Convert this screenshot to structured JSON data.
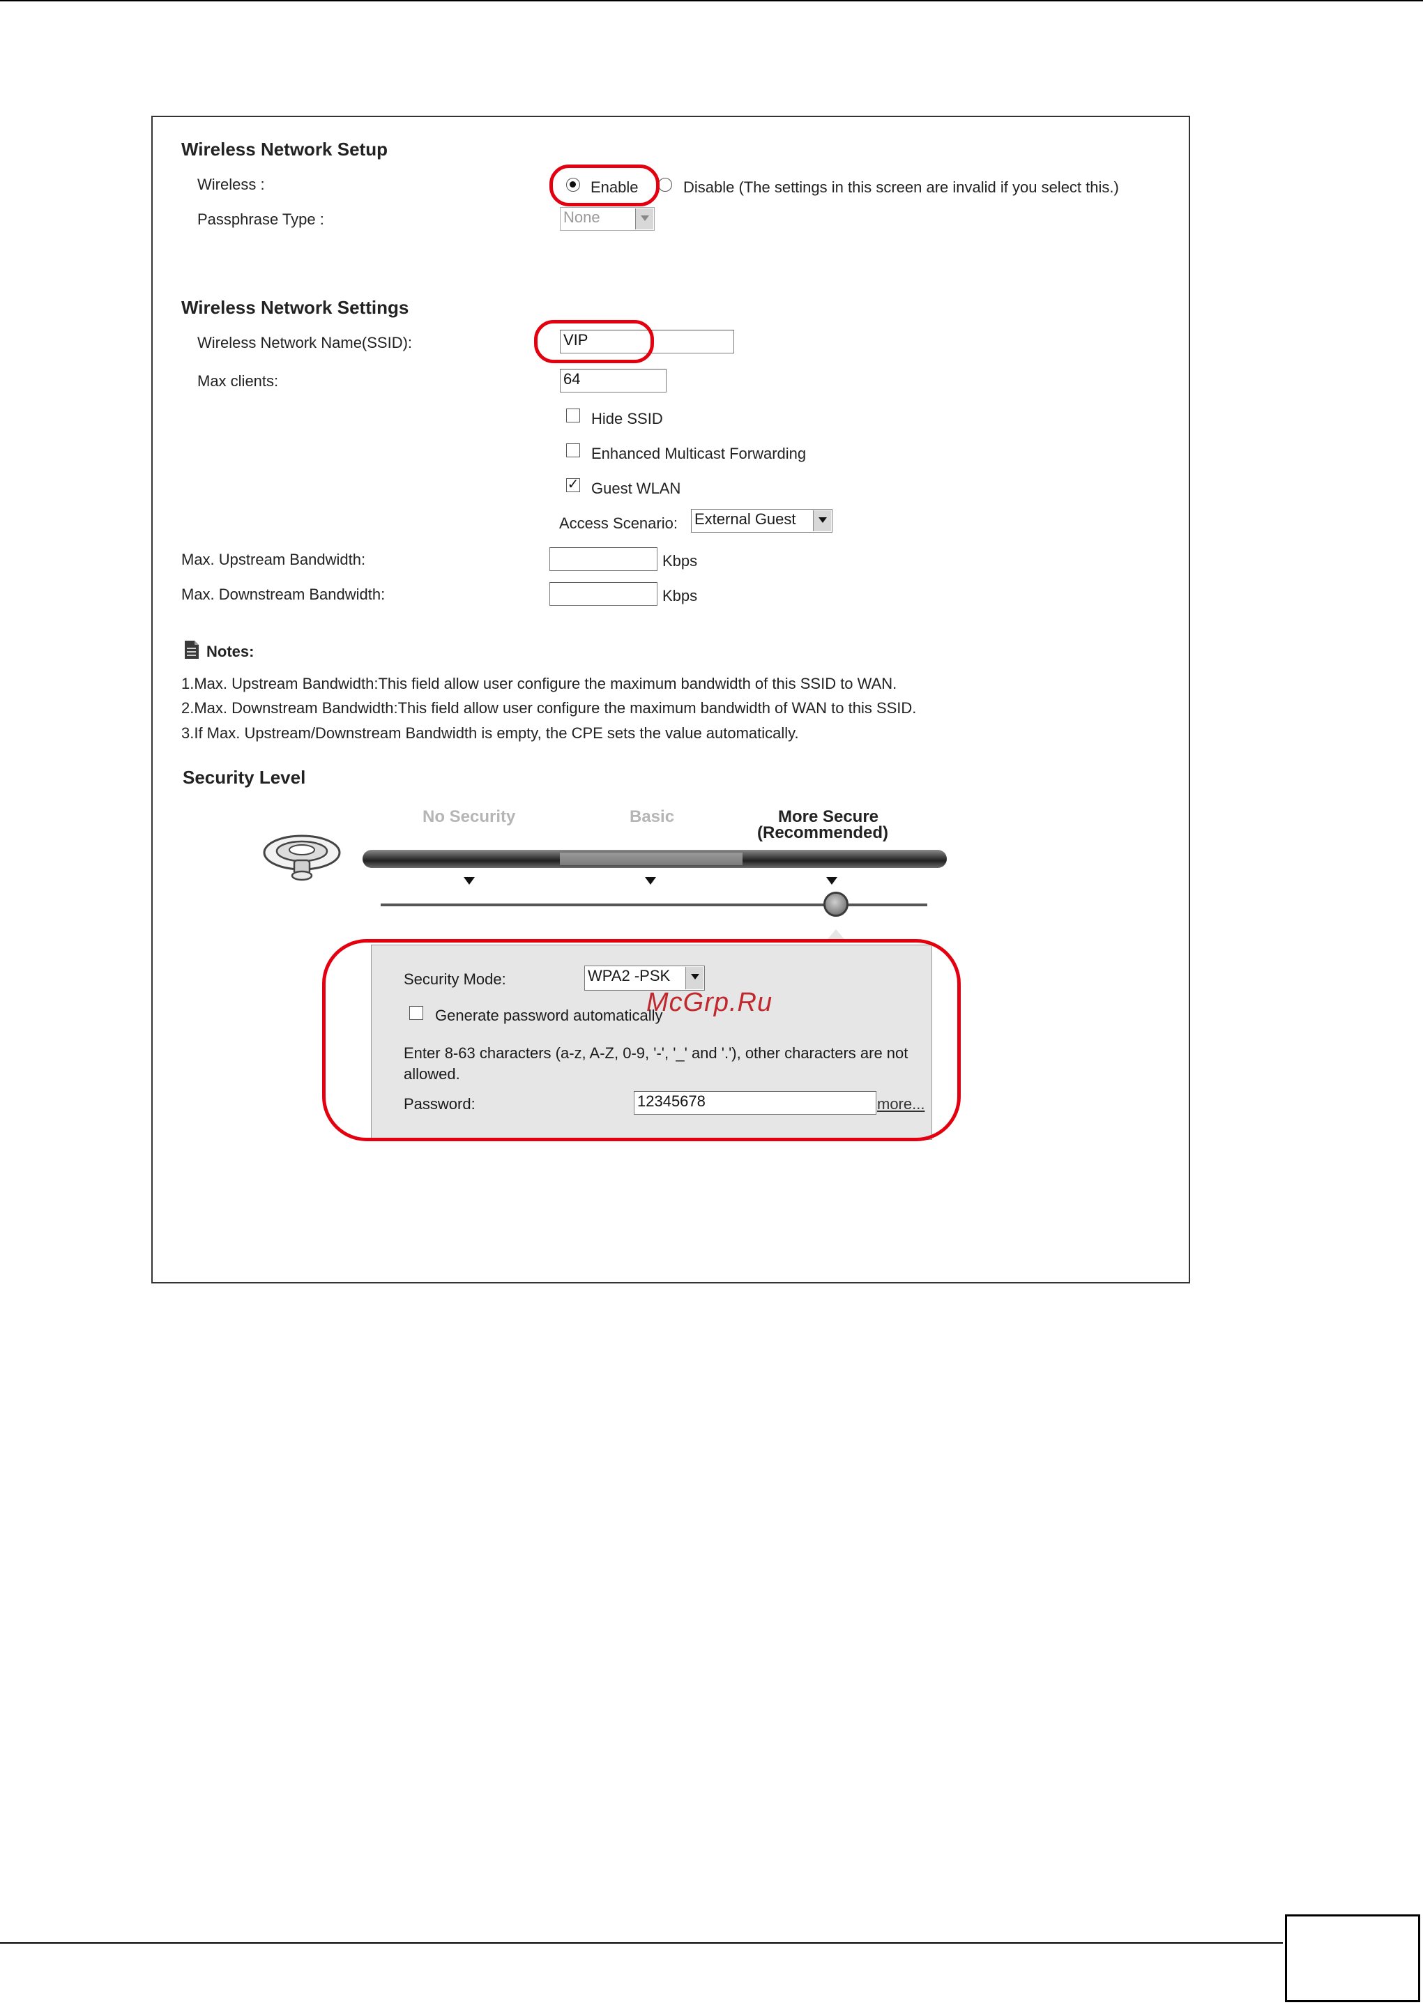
{
  "setup": {
    "title": "Wireless Network Setup",
    "wireless_label": "Wireless :",
    "enable_label": "Enable",
    "disable_label": "Disable (The settings in this screen are invalid if you select this.)",
    "passphrase_label": "Passphrase Type :",
    "passphrase_value": "None"
  },
  "settings": {
    "title": "Wireless Network Settings",
    "ssid_label": "Wireless Network Name(SSID):",
    "ssid_value": "VIP",
    "max_clients_label": "Max clients:",
    "max_clients_value": "64",
    "hide_ssid_label": "Hide SSID",
    "multicast_label": "Enhanced Multicast Forwarding",
    "guest_wlan_label": "Guest WLAN",
    "guest_wlan_checked": true,
    "access_scenario_label": "Access Scenario:",
    "access_scenario_value": "External Guest",
    "upstream_label": "Max. Upstream Bandwidth:",
    "downstream_label": "Max. Downstream Bandwidth:",
    "kbps": "Kbps"
  },
  "notes": {
    "title": "Notes:",
    "line1": "1.Max. Upstream Bandwidth:This field allow user configure the maximum bandwidth of this SSID to WAN.",
    "line2": "2.Max. Downstream Bandwidth:This field allow user configure the maximum bandwidth of WAN to this SSID.",
    "line3": "3.If Max. Upstream/Downstream Bandwidth is empty, the CPE sets the value automatically."
  },
  "security": {
    "title": "Security Level",
    "level_no_security": "No Security",
    "level_basic": "Basic",
    "level_more_secure": "More Secure",
    "level_recommended": "(Recommended)",
    "mode_label": "Security Mode:",
    "mode_value": "WPA2 -PSK",
    "generate_label": "Generate password automatically",
    "instructions": "Enter 8-63 characters (a-z, A-Z, 0-9, '-', '_' and '.'), other characters are not allowed.",
    "password_label": "Password:",
    "password_value": "12345678",
    "more_link": "more..."
  },
  "watermark": "McGrp.Ru",
  "colors": {
    "highlight_ring": "#e3000f",
    "watermark": "#c0282d",
    "panel_bg": "#e6e6e6",
    "level_inactive": "#b5b5b5"
  },
  "icons": [
    "wifi-router-icon",
    "notes-icon",
    "dropdown-arrow-icon"
  ]
}
